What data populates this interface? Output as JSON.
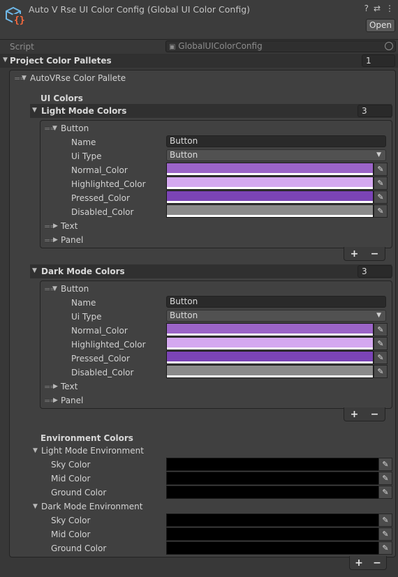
{
  "header": {
    "title": "Auto V Rse UI Color Config (Global UI Color Config)",
    "open_label": "Open",
    "help_icon": "?",
    "settings_icon": "⇄",
    "menu_icon": "⋮"
  },
  "script_row": {
    "label": "Script",
    "value": "GlobalUIColorConfig"
  },
  "palettes": {
    "label": "Project Color Palletes",
    "count": "1",
    "element_label": "AutoVRse Color Pallete"
  },
  "ui_colors": {
    "label": "UI Colors",
    "light": {
      "label": "Light Mode Colors",
      "count": "3",
      "button": {
        "label": "Button",
        "name_label": "Name",
        "name_value": "Button",
        "type_label": "Ui Type",
        "type_value": "Button",
        "normal_label": "Normal_Color",
        "highlighted_label": "Highlighted_Color",
        "pressed_label": "Pressed_Color",
        "disabled_label": "Disabled_Color"
      },
      "text_label": "Text",
      "panel_label": "Panel"
    },
    "dark": {
      "label": "Dark Mode Colors",
      "count": "3",
      "button": {
        "label": "Button",
        "name_label": "Name",
        "name_value": "Button",
        "type_label": "Ui Type",
        "type_value": "Button",
        "normal_label": "Normal_Color",
        "highlighted_label": "Highlighted_Color",
        "pressed_label": "Pressed_Color",
        "disabled_label": "Disabled_Color"
      },
      "text_label": "Text",
      "panel_label": "Panel"
    }
  },
  "env_colors": {
    "label": "Environment Colors",
    "light_label": "Light Mode Environment",
    "dark_label": "Dark Mode Environment",
    "sky_label": "Sky Color",
    "mid_label": "Mid Color",
    "ground_label": "Ground Color"
  },
  "list_controls": {
    "plus": "+",
    "minus": "−"
  },
  "colors": {
    "normal": "#9b64c8",
    "highlighted": "#d4a8f0",
    "pressed": "#7b44b6",
    "disabled": "#8a8a8a",
    "env": "#000000"
  }
}
